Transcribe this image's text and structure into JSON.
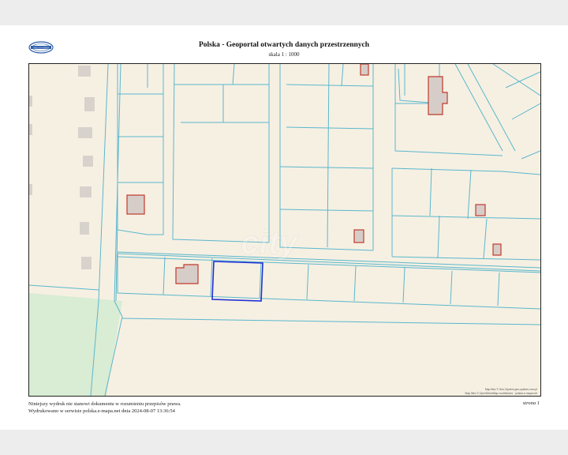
{
  "header": {
    "logo_text": "GEO-SYSTEM",
    "title": "Polska - Geoportal otwartych danych przestrzennych",
    "scale": "skala 1 : 1000"
  },
  "map": {
    "watermark": "city",
    "attribution_1": "Map files © Geo-System geo-system.com.pl",
    "attribution_2": "Map files © OpenStreetMap contributors · polska.e-mapa.net"
  },
  "footer": {
    "line1": "Niniejszy wydruk nie stanowi dokumentu w rozumieniu przepisów prawa.",
    "line2": "Wydrukowano w serwisie polska.e-mapa.net dnia 2024-08-07 13:36:54",
    "page": "strona 1"
  },
  "colors": {
    "background": "#f6f0e3",
    "parcel_lines": "#5ab7cc",
    "buildings_fill": "#d7cdc8",
    "buildings_stroke": "#c0392b",
    "selected_parcel": "#1f2fd6",
    "green_area": "#d9ecd4",
    "grey_blocks": "#d8d2cc"
  }
}
